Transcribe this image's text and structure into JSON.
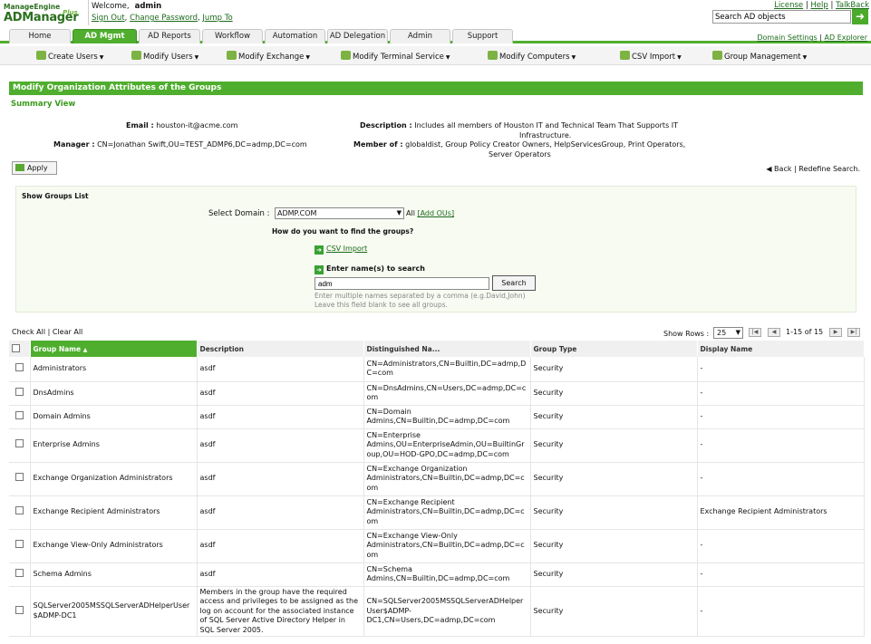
{
  "logo": {
    "brand": "ManageEngine",
    "product": "ADManager",
    "edition": "Plus"
  },
  "welcome": {
    "label": "Welcome,",
    "user": "admin"
  },
  "user_links": {
    "sign_out": "Sign Out",
    "change_password": "Change Password",
    "jump_to": "Jump To",
    "sep": ","
  },
  "top_links": {
    "license": "License",
    "help": "Help",
    "talkback": "TalkBack",
    "sep": "|"
  },
  "search": {
    "placeholder": "Search AD objects",
    "value": "Search AD objects"
  },
  "tabs": [
    "Home",
    "AD Mgmt",
    "AD Reports",
    "Workflow",
    "Automation",
    "AD Delegation",
    "Admin",
    "Support"
  ],
  "right_links": {
    "domain_settings": "Domain Settings",
    "sep": "|",
    "ad_explorer": "AD Explorer"
  },
  "subnav": [
    "Create Users",
    "Modify Users",
    "Modify Exchange",
    "Modify Terminal Service",
    "Modify Computers",
    "CSV Import",
    "Group Management"
  ],
  "page_title": "Modify Organization Attributes of the Groups",
  "summary_view": "Summary View",
  "summary": {
    "email_label": "Email :",
    "email": "houston-it@acme.com",
    "manager_label": "Manager :",
    "manager": "CN=Jonathan Swift,OU=TEST_ADMP6,DC=admp,DC=com",
    "description_label": "Description :",
    "description_1": "Includes all members of Houston IT and Technical Team That Supports IT",
    "description_2": "Infrastructure.",
    "memberof_label": "Member of :",
    "memberof_1": "globaldist, Group Policy Creator Owners, HelpServicesGroup, Print Operators,",
    "memberof_2": "Server Operators"
  },
  "apply": "Apply",
  "back": "Back",
  "back_sep": "|",
  "redefine": "Redefine Search.",
  "panel": {
    "title": "Show Groups List",
    "select_domain_label": "Select Domain :",
    "domain": "ADMP.COM",
    "all": "All",
    "add_ous": "[Add OUs]",
    "how_label": "How do you want to find the groups?",
    "csv_import": "CSV Import",
    "enter_names": "Enter name(s) to search",
    "name_value": "adm",
    "search_btn": "Search",
    "hint1": "Enter multiple names separated by a comma (e.g.David,John)",
    "hint2": "Leave this field blank to see all groups."
  },
  "list_controls": {
    "check_all": "Check All",
    "sep": "|",
    "clear_all": "Clear All",
    "show_rows_label": "Show Rows :",
    "rows": "25",
    "page_info": "1-15 of 15"
  },
  "columns": [
    "Group Name",
    "Description",
    "Distinguished Na...",
    "Group Type",
    "Display Name"
  ],
  "rows": [
    {
      "name": "Administrators",
      "desc": "asdf",
      "dn": "CN=Administrators,CN=Builtin,DC=admp,DC=com",
      "type": "Security",
      "display": "-"
    },
    {
      "name": "DnsAdmins",
      "desc": "asdf",
      "dn": "CN=DnsAdmins,CN=Users,DC=admp,DC=com",
      "type": "Security",
      "display": "-"
    },
    {
      "name": "Domain Admins",
      "desc": "asdf",
      "dn": "CN=Domain Admins,CN=Builtin,DC=admp,DC=com",
      "type": "Security",
      "display": "-"
    },
    {
      "name": "Enterprise Admins",
      "desc": "asdf",
      "dn": "CN=Enterprise Admins,OU=EnterpriseAdmin,OU=BuiltinGroup,OU=HOD-GPO,DC=admp,DC=com",
      "type": "Security",
      "display": "-"
    },
    {
      "name": "Exchange Organization Administrators",
      "desc": "asdf",
      "dn": "CN=Exchange Organization Administrators,CN=Builtin,DC=admp,DC=com",
      "type": "Security",
      "display": "-"
    },
    {
      "name": "Exchange Recipient Administrators",
      "desc": "asdf",
      "dn": "CN=Exchange Recipient Administrators,CN=Builtin,DC=admp,DC=com",
      "type": "Security",
      "display": "Exchange Recipient Administrators"
    },
    {
      "name": "Exchange View-Only Administrators",
      "desc": "asdf",
      "dn": "CN=Exchange View-Only Administrators,CN=Builtin,DC=admp,DC=com",
      "type": "Security",
      "display": "-"
    },
    {
      "name": "Schema Admins",
      "desc": "asdf",
      "dn": "CN=Schema Admins,CN=Builtin,DC=admp,DC=com",
      "type": "Security",
      "display": "-"
    },
    {
      "name": "SQLServer2005MSSQLServerADHelperUser$ADMP-DC1",
      "desc": "Members in the group have the required access and privileges to be assigned as the log on account for the associated instance of SQL Server Active Directory Helper in SQL Server 2005.",
      "dn": "CN=SQLServer2005MSSQLServerADHelperUser$ADMP-DC1,CN=Users,DC=admp,DC=com",
      "type": "Security",
      "display": "-"
    }
  ]
}
